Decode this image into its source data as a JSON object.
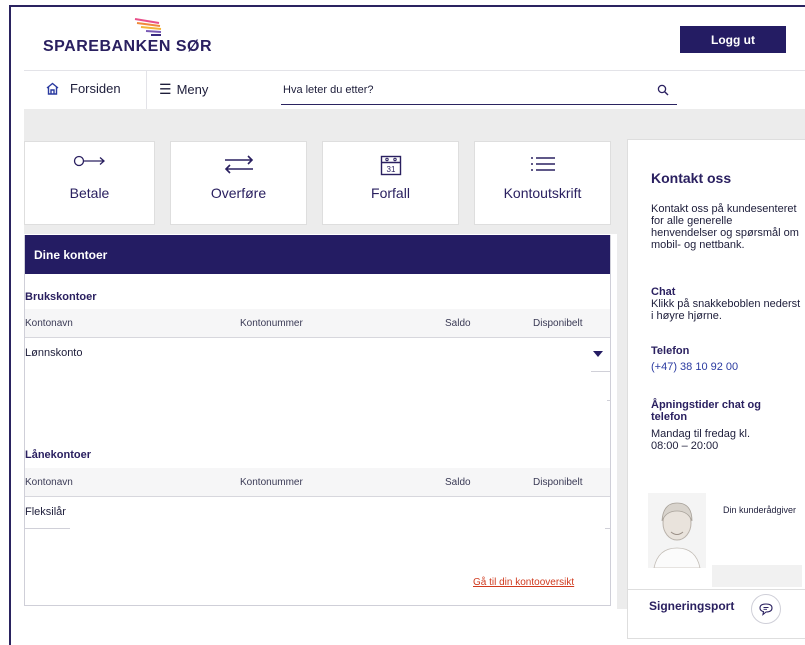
{
  "brand": {
    "name": "SPAREBANKEN SØR",
    "logo_icon": "fan-stripes-icon"
  },
  "header": {
    "logout_label": "Logg ut"
  },
  "nav": {
    "home_label": "Forsiden",
    "menu_label": "Meny",
    "search_placeholder": "Hva leter du etter?"
  },
  "tiles": [
    {
      "label": "Betale",
      "icon": "arrow-right-circle-icon"
    },
    {
      "label": "Overføre",
      "icon": "transfer-arrows-icon"
    },
    {
      "label": "Forfall",
      "icon": "calendar-icon",
      "day": "31"
    },
    {
      "label": "Kontoutskrift",
      "icon": "list-icon"
    }
  ],
  "accounts": {
    "title": "Dine kontoer",
    "columns": {
      "name": "Kontonavn",
      "number": "Kontonummer",
      "balance": "Saldo",
      "available": "Disponibelt"
    },
    "checking": {
      "title": "Brukskontoer",
      "rows": [
        {
          "name": "Lønnskonto"
        }
      ]
    },
    "loans": {
      "title": "Lånekontoer",
      "rows": [
        {
          "name": "Fleksilår"
        }
      ]
    },
    "overview_link": "Gå til din kontooversikt"
  },
  "contact": {
    "title": "Kontakt oss",
    "intro": "Kontakt oss på kundesenteret for alle generelle henvendelser og spørsmål om mobil- og nettbank.",
    "chat_title": "Chat",
    "chat_text": "Klikk på snakkeboblen nederst i høyre hjørne.",
    "phone_title": "Telefon",
    "phone": "(+47) 38 10 92 00",
    "hours_title": "Åpningstider chat og telefon",
    "hours_text": "Mandag til fredag kl. 08:00 – 20:00",
    "advisor_label": "Din kunderådgiver",
    "signing_label": "Signeringsport"
  },
  "colors": {
    "navy": "#241c63",
    "link_red": "#d03a1e",
    "panel_gray": "#ececec"
  }
}
